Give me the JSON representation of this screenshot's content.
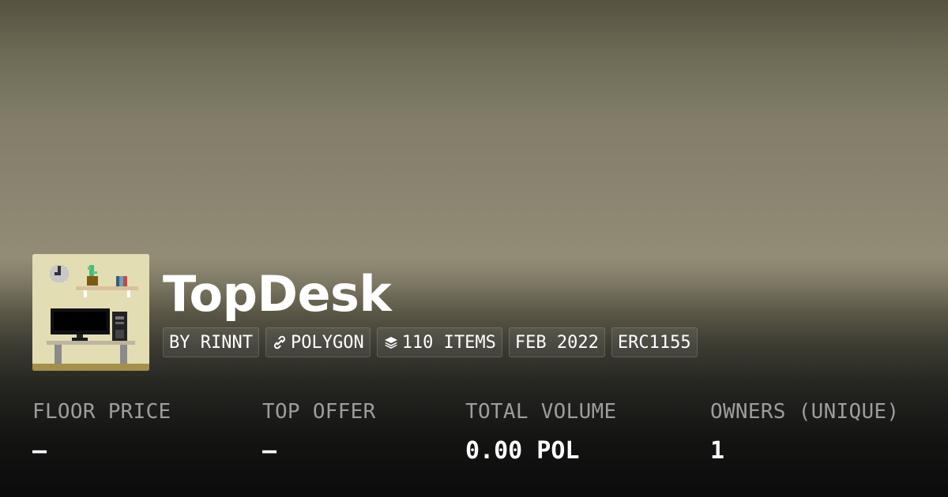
{
  "collection": {
    "name": "TopDesk",
    "avatar_icon": "pixel-desk-computer-avatar"
  },
  "chips": {
    "creator": "BY RINNT",
    "chain": "POLYGON",
    "chain_icon": "chain-link-icon",
    "items": "110 ITEMS",
    "items_icon": "layers-icon",
    "date": "FEB 2022",
    "standard": "ERC1155"
  },
  "stats": {
    "floor_price": {
      "label": "FLOOR PRICE",
      "value": "—"
    },
    "top_offer": {
      "label": "TOP OFFER",
      "value": "—"
    },
    "total_volume": {
      "label": "TOTAL VOLUME",
      "value": "0.00 POL"
    },
    "owners": {
      "label": "OWNERS (UNIQUE)",
      "value": "1"
    }
  },
  "colors": {
    "text_primary": "#ffffff",
    "text_muted": "#9d9d9d",
    "avatar_bg": "#e3ddb4"
  }
}
